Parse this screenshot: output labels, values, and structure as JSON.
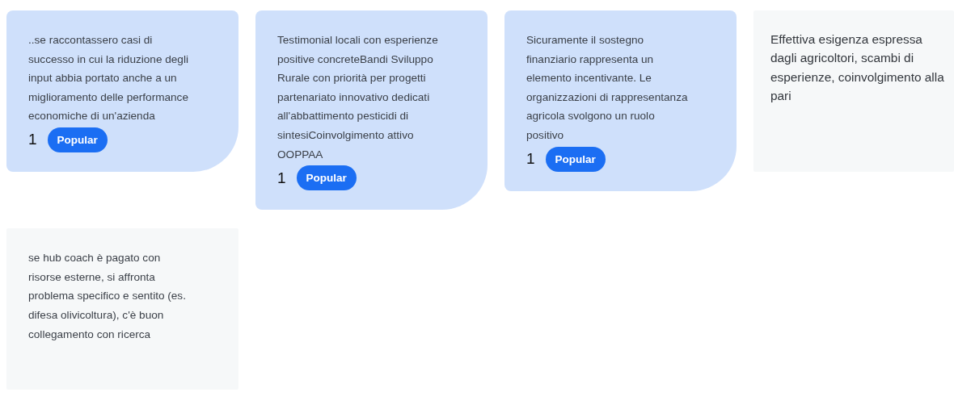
{
  "cards": [
    {
      "kind": "popular",
      "text": "..se raccontassero casi di successo in cui la riduzione degli input abbia portato anche a un miglioramento delle performance economiche di un'azienda",
      "votes": "1",
      "badge": "Popular"
    },
    {
      "kind": "popular",
      "text": "Testimonial locali con esperienze positive concreteBandi Sviluppo Rurale con priorità per progetti partenariato innovativo dedicati all'abbattimento pesticidi di sintesiCoinvolgimento attivo OOPPAA",
      "votes": "1",
      "badge": "Popular"
    },
    {
      "kind": "popular",
      "text": "Sicuramente il sostegno finanziario rappresenta un elemento incentivante. Le organizzazioni di rappresentanza agricola svolgono un ruolo positivo",
      "votes": "1",
      "badge": "Popular"
    },
    {
      "kind": "large",
      "text": "Effettiva esigenza espressa dagli agricoltori, scambi di esperienze, coinvolgimento alla pari"
    },
    {
      "kind": "plain",
      "text": "se hub coach è pagato con risorse esterne, si affronta problema specifico e sentito (es. difesa olivicoltura), c'è buon collegamento con ricerca"
    }
  ]
}
